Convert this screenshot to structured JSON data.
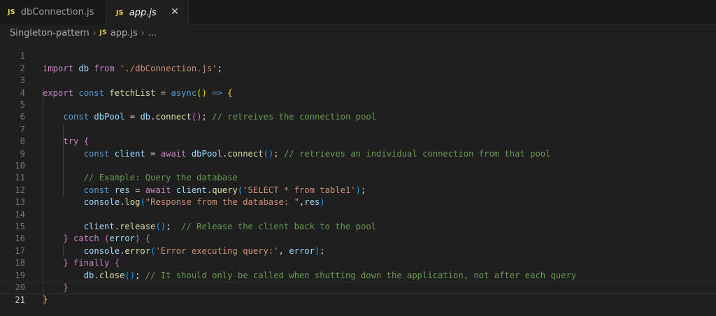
{
  "tabs": [
    {
      "badge": "JS",
      "label": "dbConnection.js",
      "active": false
    },
    {
      "badge": "JS",
      "label": "app.js",
      "active": true,
      "close": "✕"
    }
  ],
  "breadcrumb": {
    "folder": "Singleton-pattern",
    "sep": "›",
    "badge": "JS",
    "file": "app.js",
    "more": "..."
  },
  "editor": {
    "current_line": 21,
    "lines": [
      {
        "n": "1"
      },
      {
        "n": "2"
      },
      {
        "n": "3"
      },
      {
        "n": "4"
      },
      {
        "n": "5"
      },
      {
        "n": "6"
      },
      {
        "n": "7"
      },
      {
        "n": "8"
      },
      {
        "n": "9"
      },
      {
        "n": "10"
      },
      {
        "n": "11"
      },
      {
        "n": "12"
      },
      {
        "n": "13"
      },
      {
        "n": "14"
      },
      {
        "n": "15"
      },
      {
        "n": "16"
      },
      {
        "n": "17"
      },
      {
        "n": "18"
      },
      {
        "n": "19"
      },
      {
        "n": "20"
      },
      {
        "n": "21"
      }
    ],
    "tokens": {
      "l1": [
        "import",
        "db",
        "from",
        "'./dbConnection.js'",
        ";"
      ],
      "l3": [
        "export",
        "const",
        "fetchList",
        "=",
        "async",
        "(",
        ")",
        "=>",
        "{"
      ],
      "l5": [
        "const",
        "dbPool",
        "=",
        "db",
        ".",
        "connect",
        "(",
        ")",
        ";",
        "// retreives the connection pool"
      ],
      "l7": [
        "try",
        "{"
      ],
      "l8": [
        "const",
        "client",
        "=",
        "await",
        "dbPool",
        ".",
        "connect",
        "(",
        ")",
        ";",
        "// retrieves an individual connection from that pool"
      ],
      "l10": [
        "// Example: Query the database"
      ],
      "l11": [
        "const",
        "res",
        "=",
        "await",
        "client",
        ".",
        "query",
        "(",
        "'SELECT * from table1'",
        ")",
        ";"
      ],
      "l12": [
        "console",
        ".",
        "log",
        "(",
        "\"Response from the database: \"",
        ",",
        "res",
        ")"
      ],
      "l14": [
        "client",
        ".",
        "release",
        "(",
        ")",
        ";",
        "// Release the client back to the pool"
      ],
      "l15": [
        "}",
        "catch",
        "(",
        "error",
        ")",
        "{"
      ],
      "l16": [
        "console",
        ".",
        "error",
        "(",
        "'Error executing query:'",
        ", ",
        "error",
        ")",
        ";"
      ],
      "l17": [
        "}",
        "finally",
        "{"
      ],
      "l18": [
        "db",
        ".",
        "close",
        "(",
        ")",
        ";",
        "// It should only be called when shutting down the application, not after each query"
      ],
      "l19": [
        "}"
      ],
      "l20": [
        "}"
      ]
    }
  },
  "colors": {
    "keyword": "#569cd6",
    "control": "#c586c0",
    "variable": "#9cdcfe",
    "function": "#dcdcaa",
    "string": "#ce9178",
    "comment": "#6a9955"
  }
}
